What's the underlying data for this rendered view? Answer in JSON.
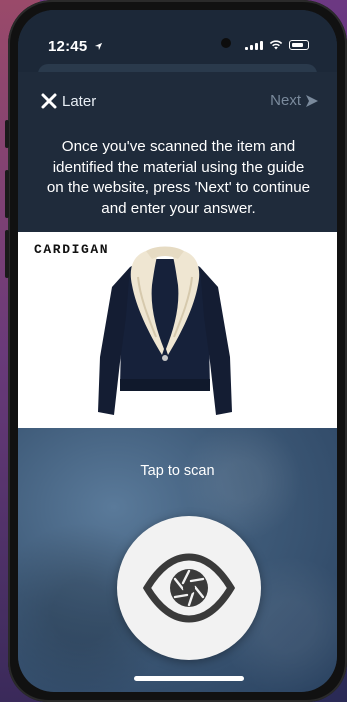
{
  "status_bar": {
    "time": "12:45",
    "location_icon": "location-arrow-icon",
    "icons": [
      "signal-icon",
      "wifi-icon",
      "battery-icon"
    ]
  },
  "nav": {
    "later_label": "Later",
    "next_label": "Next"
  },
  "instructions": "Once you've scanned the item and identified the material using the guide on the website, press 'Next' to continue and enter your answer.",
  "product": {
    "label": "CARDIGAN",
    "image": "cardigan-with-fur-collar"
  },
  "scan": {
    "label": "Tap to scan",
    "icon": "eye-aperture-icon"
  },
  "colors": {
    "header_bg": "#1f2b3b",
    "next_disabled": "#7a8a9c",
    "scan_bg": "#3e5a78"
  }
}
